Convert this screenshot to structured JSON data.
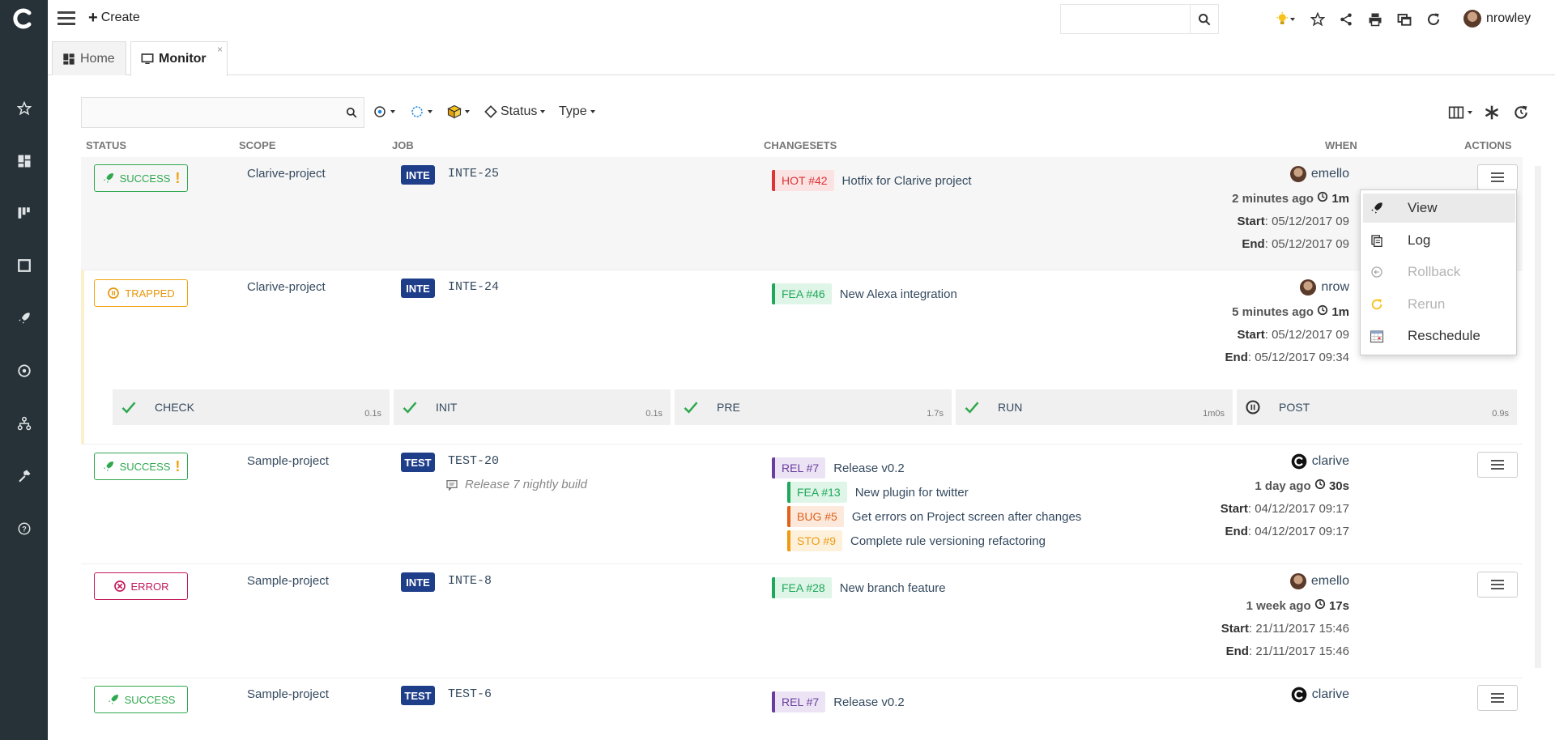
{
  "topbar": {
    "create_label": "Create",
    "search_placeholder": "",
    "username": "nrowley"
  },
  "tabs": [
    {
      "label": "Home"
    },
    {
      "label": "Monitor",
      "close": "×"
    }
  ],
  "filters": {
    "search_placeholder": "",
    "status_label": "Status",
    "type_label": "Type"
  },
  "columns": {
    "status": "STATUS",
    "scope": "SCOPE",
    "job": "JOB",
    "changesets": "CHANGESETS",
    "when": "WHEN",
    "actions": "ACTIONS"
  },
  "rows": [
    {
      "status": "SUCCESS",
      "scope": "Clarive-project",
      "job_type": "INTE",
      "job_name": "INTE-25",
      "changesets": [
        {
          "tag": "HOT #42",
          "title": "Hotfix for Clarive project"
        }
      ],
      "user": "emello",
      "ago": "2 minutes ago",
      "duration": "1m",
      "start_label": "Start",
      "start": "05/12/2017 09",
      "end_label": "End",
      "end": "05/12/2017 09"
    },
    {
      "status": "TRAPPED",
      "scope": "Clarive-project",
      "job_type": "INTE",
      "job_name": "INTE-24",
      "changesets": [
        {
          "tag": "FEA #46",
          "title": "New Alexa integration"
        }
      ],
      "user": "nrow",
      "ago": "5 minutes ago",
      "duration": "1m",
      "start_label": "Start",
      "start": "05/12/2017 09",
      "end_label": "End",
      "end": "05/12/2017 09:34",
      "stages": [
        {
          "name": "CHECK",
          "time": "0.1s"
        },
        {
          "name": "INIT",
          "time": "0.1s"
        },
        {
          "name": "PRE",
          "time": "1.7s"
        },
        {
          "name": "RUN",
          "time": "1m0s"
        },
        {
          "name": "POST",
          "time": "0.9s"
        }
      ]
    },
    {
      "status": "SUCCESS",
      "scope": "Sample-project",
      "job_type": "TEST",
      "job_name": "TEST-20",
      "comment": "Release 7 nightly build",
      "changesets": [
        {
          "tag": "REL #7",
          "title": "Release v0.2"
        },
        {
          "tag": "FEA #13",
          "title": "New plugin for twitter"
        },
        {
          "tag": "BUG #5",
          "title": "Get errors on Project screen after changes"
        },
        {
          "tag": "STO #9",
          "title": "Complete rule versioning refactoring"
        }
      ],
      "user": "clarive",
      "ago": "1 day ago",
      "duration": "30s",
      "start_label": "Start",
      "start": "04/12/2017 09:17",
      "end_label": "End",
      "end": "04/12/2017 09:17"
    },
    {
      "status": "ERROR",
      "scope": "Sample-project",
      "job_type": "INTE",
      "job_name": "INTE-8",
      "changesets": [
        {
          "tag": "FEA #28",
          "title": "New branch feature"
        }
      ],
      "user": "emello",
      "ago": "1 week ago",
      "duration": "17s",
      "start_label": "Start",
      "start": "21/11/2017 15:46",
      "end_label": "End",
      "end": "21/11/2017 15:46"
    },
    {
      "status": "SUCCESS",
      "scope": "Sample-project",
      "job_type": "TEST",
      "job_name": "TEST-6",
      "changesets": [
        {
          "tag": "REL #7",
          "title": "Release v0.2"
        }
      ],
      "user": "clarive"
    }
  ],
  "action_menu": {
    "items": [
      {
        "label": "View",
        "icon": "rocket-icon",
        "enabled": true
      },
      {
        "label": "Log",
        "icon": "log-icon",
        "enabled": true
      },
      {
        "label": "Rollback",
        "icon": "rollback-icon",
        "enabled": false
      },
      {
        "label": "Rerun",
        "icon": "rerun-icon",
        "enabled": false
      },
      {
        "label": "Reschedule",
        "icon": "calendar-icon",
        "enabled": true
      }
    ]
  },
  "colors": {
    "sidebar": "#263238",
    "success": "#2fa84f",
    "trapped": "#f0a30a",
    "error": "#c2185b",
    "job_type_bg": "#1f3e8a"
  }
}
